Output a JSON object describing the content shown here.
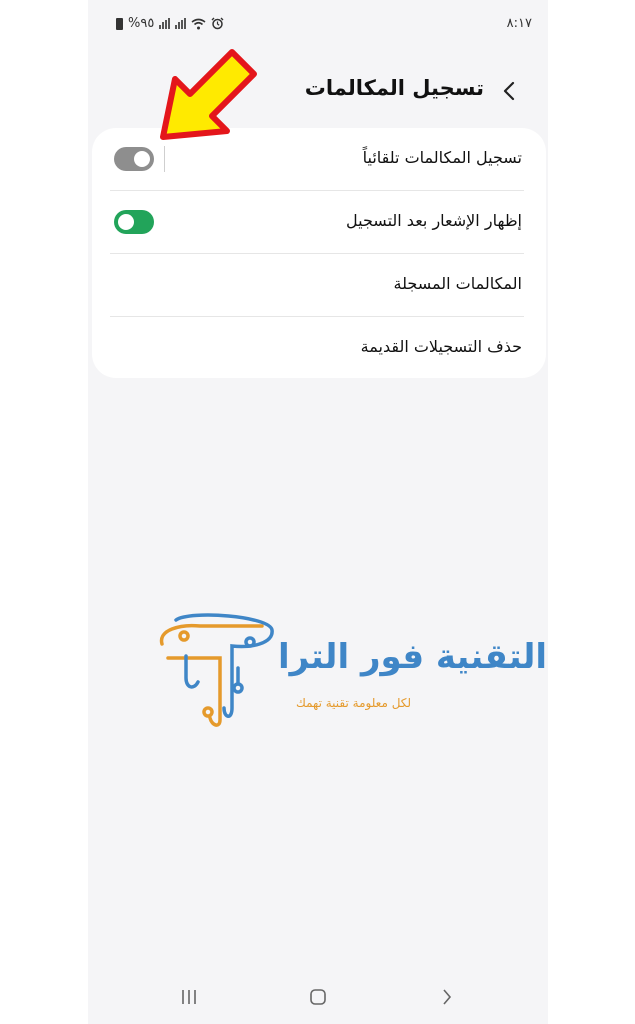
{
  "status_bar": {
    "time": "٨:١٧",
    "battery_text": "%٩٥",
    "icons": [
      "battery-icon",
      "signal-icon",
      "signal-icon",
      "wifi-icon",
      "alarm-icon"
    ]
  },
  "header": {
    "title": "تسجيل المكالمات",
    "back_icon": "chevron-left-icon"
  },
  "settings": {
    "items": [
      {
        "label": "تسجيل المكالمات تلقائياً",
        "toggle": "off"
      },
      {
        "label": "إظهار الإشعار بعد التسجيل",
        "toggle": "on"
      },
      {
        "label": "المكالمات المسجلة"
      },
      {
        "label": "حذف التسجيلات القديمة"
      }
    ]
  },
  "watermark": {
    "main": "التقنية فور الترا",
    "tagline": "لكل معلومة تقنية تهمك"
  },
  "nav_bar": {
    "icons": [
      "recent-apps-icon",
      "home-icon",
      "back-icon"
    ]
  },
  "colors": {
    "toggle_on": "#22a45a",
    "toggle_off": "#8e8e8e",
    "arrow_fill": "#ffea00",
    "arrow_outline": "#e4161b",
    "logo_blue": "#3f86c7",
    "logo_orange": "#e59a2c"
  }
}
